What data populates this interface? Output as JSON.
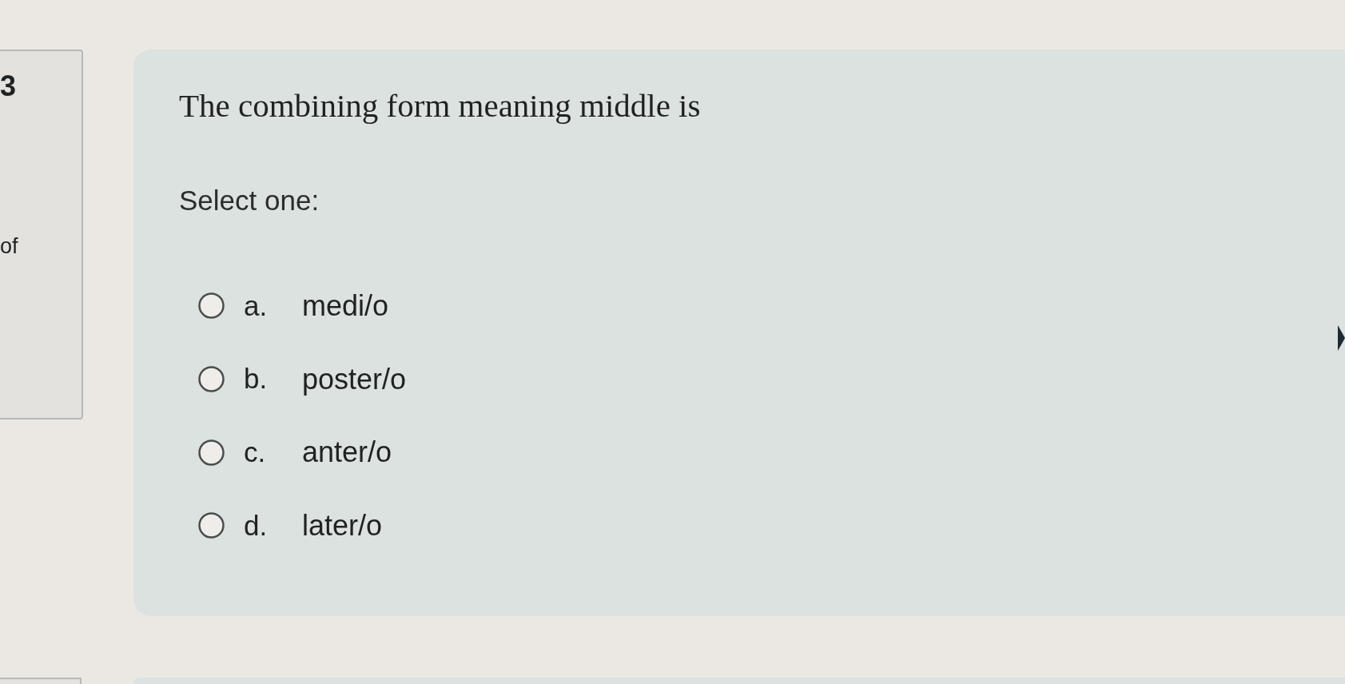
{
  "info_panel": {
    "number": "3",
    "text": "of"
  },
  "question": {
    "text": "The combining form meaning middle is",
    "prompt": "Select one:",
    "options": [
      {
        "letter": "a.",
        "text": "medi/o",
        "selected": false
      },
      {
        "letter": "b.",
        "text": "poster/o",
        "selected": false
      },
      {
        "letter": "c.",
        "text": "anter/o",
        "selected": false
      },
      {
        "letter": "d.",
        "text": "later/o",
        "selected": false
      }
    ]
  }
}
